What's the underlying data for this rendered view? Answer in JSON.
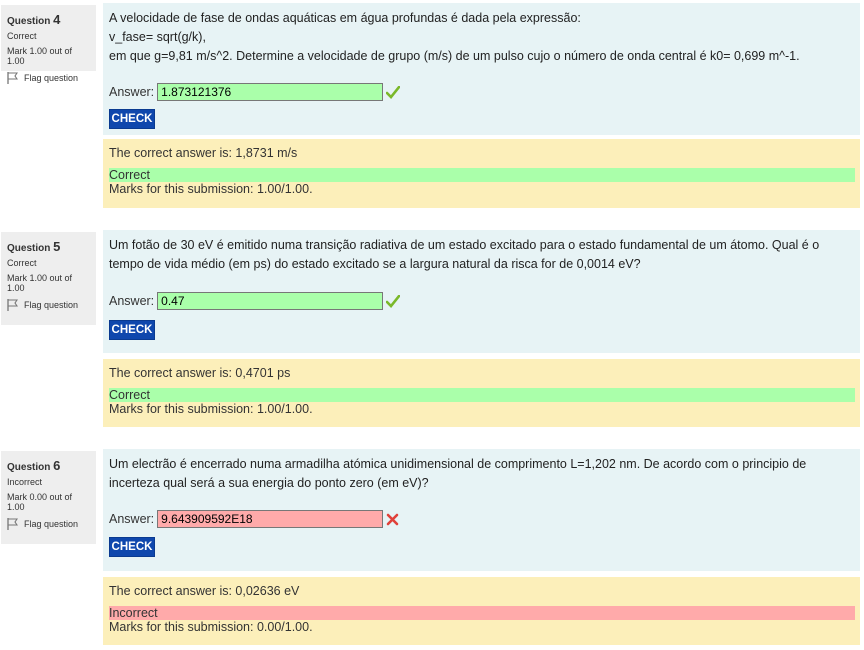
{
  "questions": [
    {
      "label": "Question",
      "number": "4",
      "state": "Correct",
      "grade": "Mark 1.00 out of 1.00",
      "flag_label": "Flag question",
      "text_lines": [
        "A velocidade de fase de ondas aquáticas em água profundas é dada pela expressão:",
        "v_fase= sqrt(g/k),",
        "em que g=9,81 m/s^2. Determine a velocidade de grupo (m/s) de um pulso cujo o número de onda central é k0= 0,699 m^-1."
      ],
      "answer_label": "Answer:",
      "answer_value": "1.873121376",
      "result": "correct",
      "check_label": "CHECK",
      "correct_answer": "The correct answer is: 1,8731 m/s",
      "status_text": "Correct",
      "marks_text": "Marks for this submission: 1.00/1.00."
    },
    {
      "label": "Question",
      "number": "5",
      "state": "Correct",
      "grade": "Mark 1.00 out of 1.00",
      "flag_label": "Flag question",
      "text_lines": [
        "Um fotão de 30 eV é emitido numa transição radiativa de um estado excitado para o estado fundamental de um átomo. Qual é o",
        "tempo de vida médio (em ps) do estado excitado se a largura natural da risca for de 0,0014 eV?"
      ],
      "answer_label": "Answer:",
      "answer_value": "0.47",
      "result": "correct",
      "check_label": "CHECK",
      "correct_answer": "The correct answer is: 0,4701 ps",
      "status_text": "Correct",
      "marks_text": "Marks for this submission: 1.00/1.00."
    },
    {
      "label": "Question",
      "number": "6",
      "state": "Incorrect",
      "grade": "Mark 0.00 out of 1.00",
      "flag_label": "Flag question",
      "text_lines": [
        "Um electrão é encerrado numa armadilha atómica unidimensional de comprimento L=1,202 nm. De acordo com o principio de",
        "incerteza qual será a sua energia do ponto zero (em eV)?"
      ],
      "answer_label": "Answer:",
      "answer_value": "9.643909592E18",
      "result": "incorrect",
      "check_label": "CHECK",
      "correct_answer": "The correct answer is: 0,02636 eV",
      "status_text": "Incorrect",
      "marks_text": "Marks for this submission: 0.00/1.00."
    }
  ],
  "colors": {
    "info_bg": "#eeeeee",
    "formulation_bg": "#e7f3f5",
    "outcome_bg": "#fcefba",
    "correct": "#aaffaa",
    "incorrect": "#ffaaaa",
    "check_button": "#0f47ad"
  },
  "icons": {
    "correct": "check-mark-icon",
    "incorrect": "cross-mark-icon",
    "flag": "flag-icon"
  }
}
